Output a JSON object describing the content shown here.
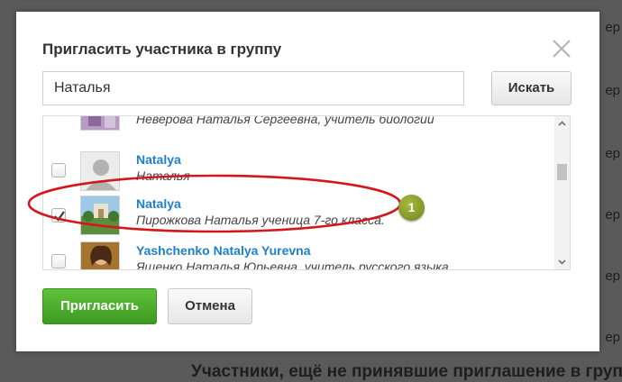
{
  "background": {
    "right_edge_labels": [
      "ер",
      "ер",
      "ер",
      "ер",
      "ер",
      "ер",
      "ер",
      "ер"
    ],
    "bottom_heading": "Участники, ещё не принявшие приглашение в группу"
  },
  "dialog": {
    "title": "Пригласить участника в группу",
    "close_icon": "close-x-icon",
    "search": {
      "value": "Наталья",
      "button_label": "Искать"
    },
    "results": [
      {
        "name": "",
        "desc": "Неверова Наталья Сергеевна, учитель биологии",
        "checked": false,
        "avatar": "purple-photo"
      },
      {
        "name": "Natalya",
        "desc": "Наталья",
        "checked": false,
        "avatar": "default-silhouette"
      },
      {
        "name": "Natalya",
        "desc": "Пирожкова Наталья ученица 7-го класса.",
        "checked": true,
        "avatar": "park-photo"
      },
      {
        "name": "Yashchenko Natalya Yurevna",
        "desc": "Ященко Наталья Юрьевна, учитель русского языка",
        "checked": false,
        "avatar": "woman-photo"
      }
    ],
    "buttons": {
      "invite": "Пригласить",
      "cancel": "Отмена"
    }
  },
  "annotation": {
    "badge_number": "1",
    "color": "#d4171d"
  },
  "colors": {
    "accent_link": "#1f7fc9",
    "primary_button": "#4caf2f",
    "highlight": "#d4171d"
  }
}
